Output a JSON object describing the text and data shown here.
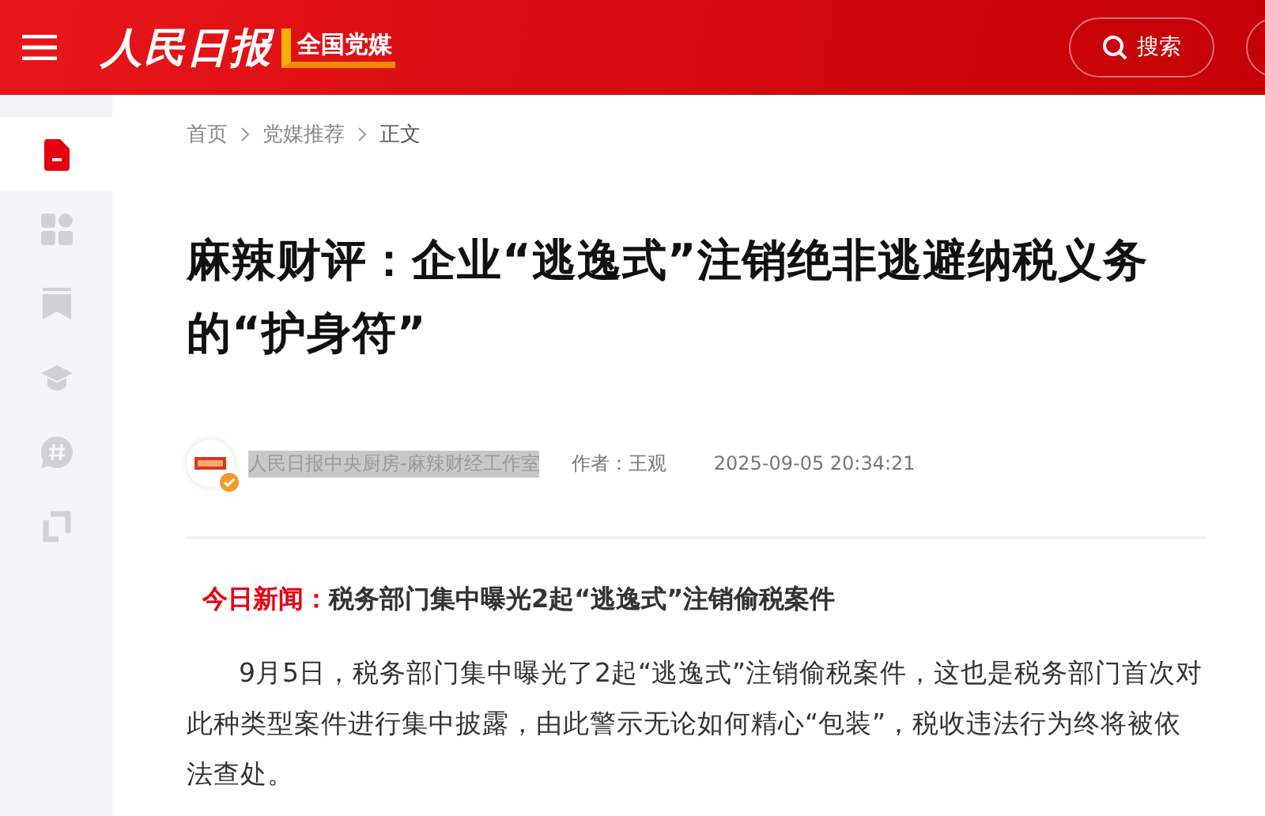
{
  "header": {
    "logo": "人民日报",
    "badge": "全国党媒",
    "search_button": "搜索"
  },
  "sidebar": {
    "items": [
      {
        "kind": "article",
        "selected": true
      },
      {
        "kind": "grid",
        "selected": false
      },
      {
        "kind": "bookmark",
        "selected": false
      },
      {
        "kind": "study",
        "selected": false
      },
      {
        "kind": "topic",
        "selected": false
      },
      {
        "kind": "copy",
        "selected": false
      }
    ]
  },
  "breadcrumb": [
    "首页",
    "党媒推荐",
    "正文"
  ],
  "article": {
    "title": "麻辣财评：企业“逃逸式”注销绝非逃避纳税义务的“护身符”",
    "source": "人民日报中央厨房-麻辣财经工作室",
    "author": "作者：王观",
    "time": "2025-09-05 20:34:21",
    "lead_label": "今日新闻：",
    "lead": "税务部门集中曝光2起“逃逸式”注销偷税案件",
    "paragraph": "9月5日，税务部门集中曝光了2起“逃逸式”注销偷税案件，这也是税务部门首次对此种类型案件进行集中披露，由此警示无论如何精心“包装”，税收违法行为终将被依法查处。"
  }
}
